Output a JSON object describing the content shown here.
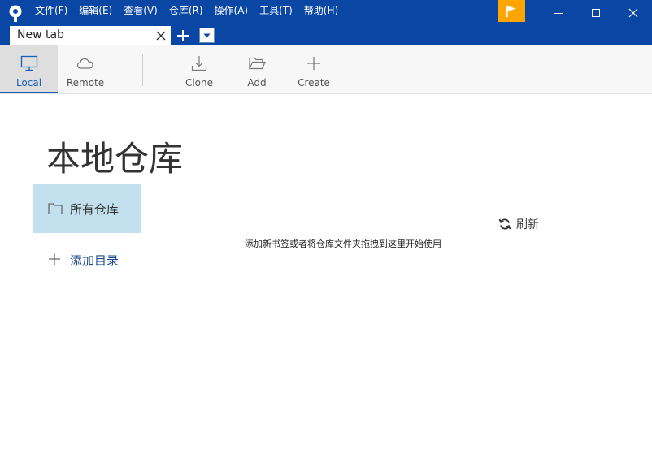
{
  "menu": {
    "file": "文件(F)",
    "edit": "编辑(E)",
    "view": "查看(V)",
    "repository": "仓库(R)",
    "actions": "操作(A)",
    "tools": "工具(T)",
    "help": "帮助(H)"
  },
  "tab": {
    "label": "New tab"
  },
  "toolbar": {
    "local": "Local",
    "remote": "Remote",
    "clone": "Clone",
    "add": "Add",
    "create": "Create"
  },
  "main": {
    "heading": "本地仓库",
    "all_repos": "所有仓库",
    "add_directory": "添加目录",
    "refresh": "刷新",
    "hint": "添加新书签或者将仓库文件夹拖拽到这里开始使用"
  },
  "colors": {
    "titlebar": "#0a47a5",
    "flag_button": "#ffa500",
    "selected_item": "#c2e0ee",
    "accent": "#1a5fb4"
  },
  "icons": {
    "logo": "sourcetree-logo-icon",
    "flag": "flag-icon",
    "minimize": "minimize-icon",
    "maximize": "maximize-icon",
    "close": "close-icon",
    "local": "monitor-icon",
    "remote": "cloud-icon",
    "clone": "download-icon",
    "add": "folder-open-icon",
    "create": "plus-icon",
    "all_repos": "folder-icon",
    "add_directory": "plus-icon",
    "refresh": "refresh-icon"
  }
}
